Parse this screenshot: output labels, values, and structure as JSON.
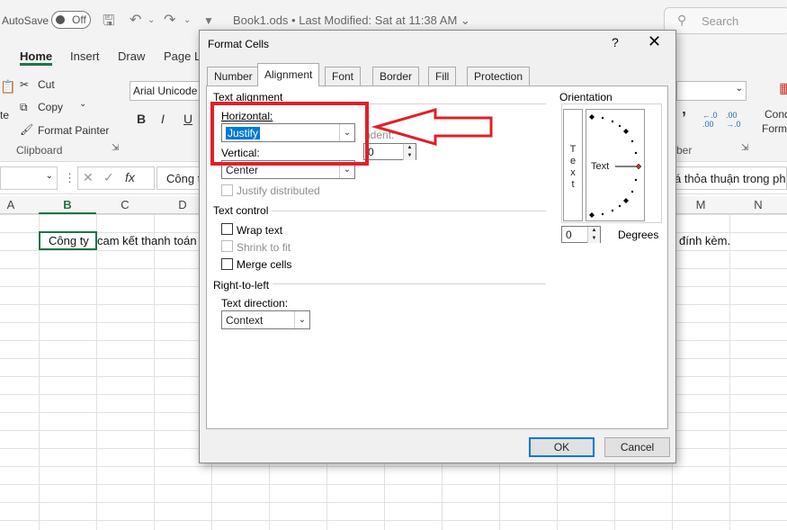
{
  "titlebar": {
    "autosave_label": "AutoSave",
    "toggle_label": "Off",
    "doc_title": "Book1.ods  •  Last Modified: Sat at 11:38 AM",
    "search_placeholder": "Search"
  },
  "ribbon_tabs": [
    "Home",
    "Insert",
    "Draw",
    "Page L"
  ],
  "ribbon": {
    "cut": "Cut",
    "copy": "Copy",
    "format_painter": "Format Painter",
    "clipboard_group": "Clipboard",
    "font_name": "Arial Unicode",
    "bold": "B",
    "italic": "I",
    "underline": "U",
    "number_group": "ber",
    "cond_format": "Cond",
    "format": "Form",
    "paste": "te"
  },
  "formula_bar": {
    "fx": "fx",
    "formula": "Công t",
    "formula_tail": "á thỏa thuận trong ph"
  },
  "columns": [
    "A",
    "B",
    "C",
    "D",
    "M",
    "N"
  ],
  "cells": {
    "b2_start": "Công ty",
    "b2_cont": "cam kết thanh toán",
    "tail": "đính kèm."
  },
  "dialog": {
    "title": "Format Cells",
    "help": "?",
    "close": "✕",
    "tabs": [
      "Number",
      "Alignment",
      "Font",
      "Border",
      "Fill",
      "Protection"
    ],
    "active_tab": "Alignment",
    "text_alignment": {
      "title": "Text alignment",
      "horizontal_label": "Horizontal:",
      "horizontal_value": "Justify",
      "indent_label": "ndent:",
      "indent_value": "0",
      "vertical_label": "Vertical:",
      "vertical_value": "Center",
      "justify_distributed": "Justify distributed"
    },
    "text_control": {
      "title": "Text control",
      "wrap_text": "Wrap text",
      "shrink_to_fit": "Shrink to fit",
      "merge_cells": "Merge cells"
    },
    "rtl": {
      "title": "Right-to-left",
      "direction_label": "Text direction:",
      "direction_value": "Context"
    },
    "orientation": {
      "title": "Orientation",
      "vertical_text": [
        "T",
        "e",
        "x",
        "t"
      ],
      "dial_text": "Text",
      "degrees_value": "0",
      "degrees_label": "Degrees"
    },
    "ok": "OK",
    "cancel": "Cancel"
  },
  "colors": {
    "excel_green": "#217346",
    "selection_blue": "#0078d7",
    "annotation_red": "#e0202a"
  }
}
